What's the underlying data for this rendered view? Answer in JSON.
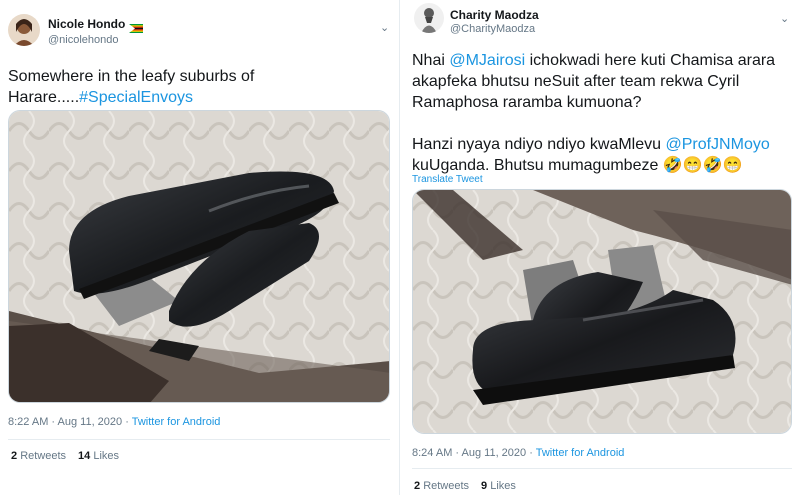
{
  "left_tweet": {
    "name": "Nicole Hondo",
    "handle": "@nicolehondo",
    "text_before": "Somewhere in the leafy suburbs of Harare.....",
    "hashtag": "#SpecialEnvoys",
    "timestamp": "8:22 AM · Aug 11, 2020 · ",
    "source": "Twitter for Android",
    "retweets_count": "2",
    "retweets_label": "Retweets",
    "likes_count": "14",
    "likes_label": "Likes"
  },
  "right_tweet": {
    "name": "Charity Maodza",
    "handle": "@CharityMaodza",
    "p1_prefix": "Nhai ",
    "p1_mention": "@MJairosi",
    "p1_text": " ichokwadi here kuti Chamisa arara akapfeka bhutsu neSuit after team rekwa Cyril Ramaphosa raramba kumuona?",
    "p2_prefix": "Hanzi nyaya ndiyo ndiyo kwaMlevu ",
    "p2_mention": "@ProfJNMoyo",
    "p2_text": " kuUganda. Bhutsu mumagumbeze 🤣😁🤣😁",
    "translate": "Translate Tweet",
    "timestamp": "8:24 AM · Aug 11, 2020 · ",
    "source": "Twitter for Android",
    "retweets_count": "2",
    "retweets_label": "Retweets",
    "likes_count": "9",
    "likes_label": "Likes"
  },
  "icons": {
    "caret": "chevron-down-icon",
    "flag": "zimbabwe-flag-icon"
  },
  "colors": {
    "link": "#1b95e0",
    "secondary": "#657786",
    "text": "#14171a"
  }
}
